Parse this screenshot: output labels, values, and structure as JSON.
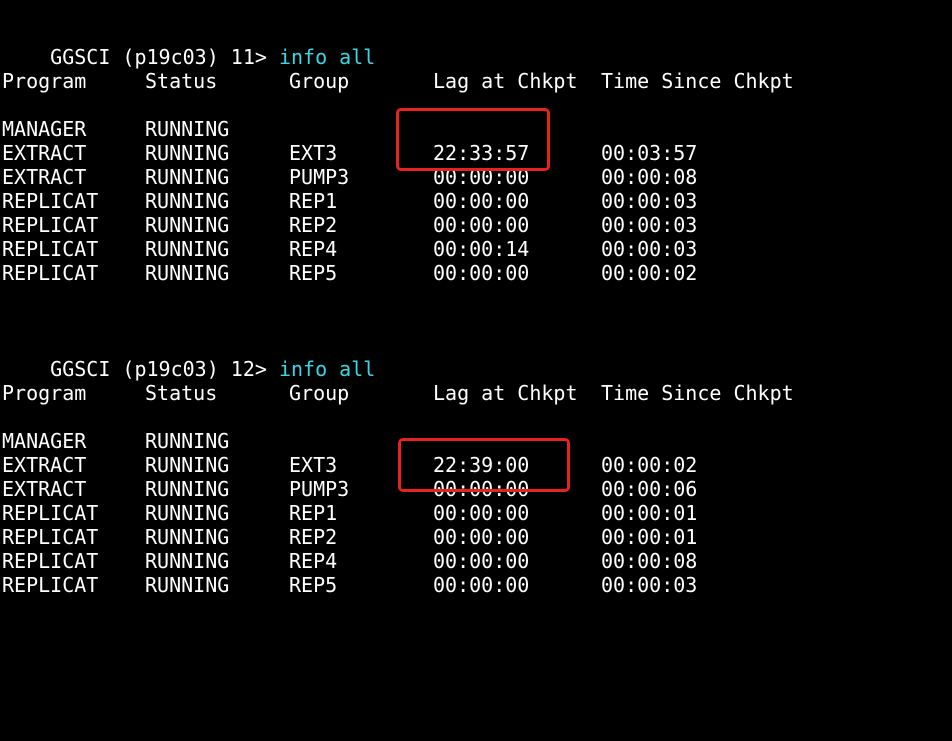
{
  "session1": {
    "prompt": "GGSCI (p19c03) 11> ",
    "command": "info all",
    "header": [
      "Program",
      "Status",
      "Group",
      "Lag at Chkpt",
      "Time Since Chkpt"
    ],
    "rows": [
      {
        "program": "MANAGER",
        "status": "RUNNING",
        "group": "",
        "lag": "",
        "since": ""
      },
      {
        "program": "EXTRACT",
        "status": "RUNNING",
        "group": "EXT3",
        "lag": "22:33:57",
        "since": "00:03:57"
      },
      {
        "program": "EXTRACT",
        "status": "RUNNING",
        "group": "PUMP3",
        "lag": "00:00:00",
        "since": "00:00:08"
      },
      {
        "program": "REPLICAT",
        "status": "RUNNING",
        "group": "REP1",
        "lag": "00:00:00",
        "since": "00:00:03"
      },
      {
        "program": "REPLICAT",
        "status": "RUNNING",
        "group": "REP2",
        "lag": "00:00:00",
        "since": "00:00:03"
      },
      {
        "program": "REPLICAT",
        "status": "RUNNING",
        "group": "REP4",
        "lag": "00:00:14",
        "since": "00:00:03"
      },
      {
        "program": "REPLICAT",
        "status": "RUNNING",
        "group": "REP5",
        "lag": "00:00:00",
        "since": "00:00:02"
      }
    ]
  },
  "session2": {
    "prompt": "GGSCI (p19c03) 12> ",
    "command": "info all",
    "header": [
      "Program",
      "Status",
      "Group",
      "Lag at Chkpt",
      "Time Since Chkpt"
    ],
    "rows": [
      {
        "program": "MANAGER",
        "status": "RUNNING",
        "group": "",
        "lag": "",
        "since": ""
      },
      {
        "program": "EXTRACT",
        "status": "RUNNING",
        "group": "EXT3",
        "lag": "22:39:00",
        "since": "00:00:02"
      },
      {
        "program": "EXTRACT",
        "status": "RUNNING",
        "group": "PUMP3",
        "lag": "00:00:00",
        "since": "00:00:06"
      },
      {
        "program": "REPLICAT",
        "status": "RUNNING",
        "group": "REP1",
        "lag": "00:00:00",
        "since": "00:00:01"
      },
      {
        "program": "REPLICAT",
        "status": "RUNNING",
        "group": "REP2",
        "lag": "00:00:00",
        "since": "00:00:01"
      },
      {
        "program": "REPLICAT",
        "status": "RUNNING",
        "group": "REP4",
        "lag": "00:00:00",
        "since": "00:00:08"
      },
      {
        "program": "REPLICAT",
        "status": "RUNNING",
        "group": "REP5",
        "lag": "00:00:00",
        "since": "00:00:03"
      }
    ]
  },
  "colors": {
    "background": "#000000",
    "text": "#ffffff",
    "command": "#3ad7e6",
    "annotation": "#e8231f"
  }
}
